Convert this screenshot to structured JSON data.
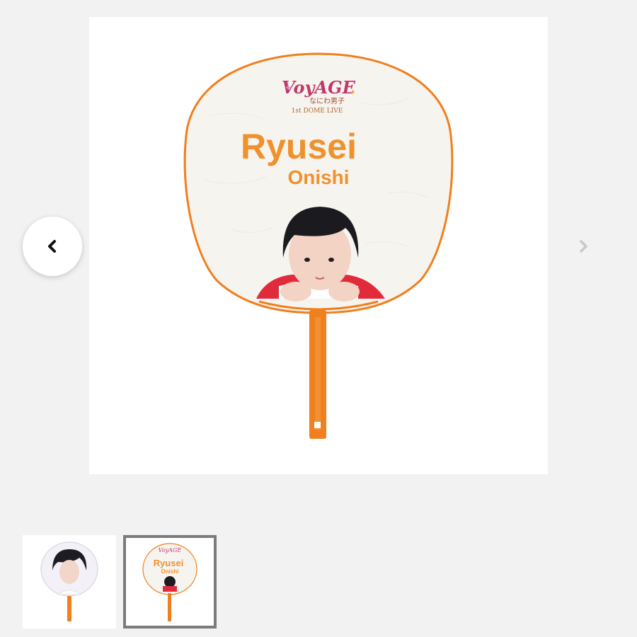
{
  "gallery": {
    "main_image": {
      "logo_text": "VoyAGE",
      "logo_sub_jp": "なにわ男子",
      "logo_sub_en": "1st DOME LIVE",
      "name_first": "Ryusei",
      "name_last": "Onishi"
    },
    "nav": {
      "prev_icon": "chevron-left-icon",
      "next_icon": "chevron-right-icon"
    },
    "thumbnails": [
      {
        "selected": false
      },
      {
        "selected": true,
        "name_first": "Ryusei",
        "name_last": "Onishi",
        "logo_text": "VoyAGE"
      }
    ],
    "colors": {
      "accent_orange": "#f07f1e",
      "background": "#f2f2f2",
      "selected_border": "#7b7b7b"
    }
  }
}
